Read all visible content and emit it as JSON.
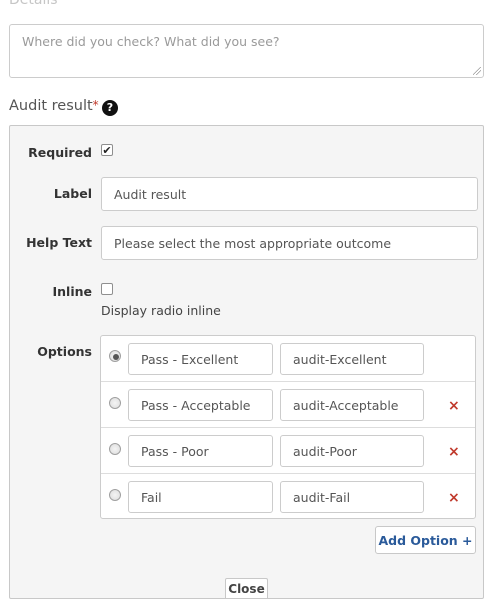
{
  "details": {
    "label": "Details",
    "required_marker": "*",
    "placeholder": "Where did you check? What did you see?"
  },
  "field": {
    "title": "Audit result",
    "required_marker": "*",
    "help_icon": "?"
  },
  "editor": {
    "required": {
      "label": "Required",
      "checked": true,
      "check_glyph": "✔"
    },
    "label_field": {
      "label": "Label",
      "value": "Audit result"
    },
    "help_text": {
      "label": "Help Text",
      "value": "Please select the most appropriate outcome"
    },
    "inline": {
      "label": "Inline",
      "checked": false,
      "description": "Display radio inline"
    },
    "options": {
      "label": "Options",
      "items": [
        {
          "text": "Pass - Excellent",
          "value": "audit-Excellent",
          "selected": true,
          "removable": false
        },
        {
          "text": "Pass - Acceptable",
          "value": "audit-Acceptable",
          "selected": false,
          "removable": true
        },
        {
          "text": "Pass - Poor",
          "value": "audit-Poor",
          "selected": false,
          "removable": true
        },
        {
          "text": "Fail",
          "value": "audit-Fail",
          "selected": false,
          "removable": true
        }
      ],
      "remove_glyph": "×"
    },
    "add_option_label": "Add Option +",
    "close_label": "Close"
  },
  "colors": {
    "link_blue": "#2a5a9a",
    "remove_red": "#c0392b"
  }
}
